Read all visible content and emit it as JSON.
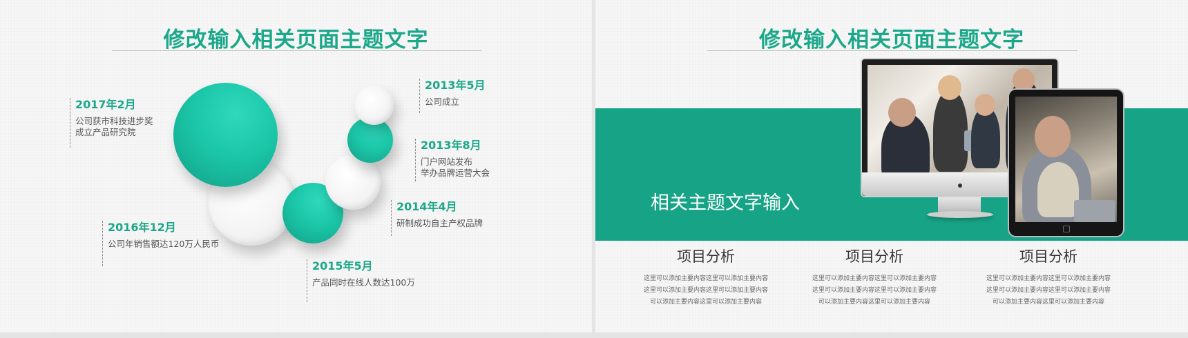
{
  "left_slide": {
    "title": "修改输入相关页面主题文字",
    "timeline": [
      {
        "date": "2013年5月",
        "desc": "公司成立"
      },
      {
        "date": "2013年8月",
        "desc": "门户网站发布\n举办品牌运营大会"
      },
      {
        "date": "2014年4月",
        "desc": "研制成功自主产权品牌"
      },
      {
        "date": "2015年5月",
        "desc": "产品同时在线人数达100万"
      },
      {
        "date": "2016年12月",
        "desc": "公司年销售额达120万人民币"
      },
      {
        "date": "2017年2月",
        "desc": "公司获市科技进步奖\n成立产品研究院"
      }
    ]
  },
  "right_slide": {
    "title": "修改输入相关页面主题文字",
    "band_text": "相关主题文字输入",
    "items": [
      {
        "title": "项目分析",
        "desc": "这里可以添加主要内容这里可以添加主要内容\n这里可以添加主要内容这里可以添加主要内容\n可以添加主要内容这里可以添加主要内容"
      },
      {
        "title": "项目分析",
        "desc": "这里可以添加主要内容这里可以添加主要内容\n这里可以添加主要内容这里可以添加主要内容\n可以添加主要内容这里可以添加主要内容"
      },
      {
        "title": "项目分析",
        "desc": "这里可以添加主要内容这里可以添加主要内容\n这里可以添加主要内容这里可以添加主要内容\n可以添加主要内容这里可以添加主要内容"
      }
    ]
  },
  "colors": {
    "accent": "#1ba88a",
    "band": "#17a386"
  }
}
